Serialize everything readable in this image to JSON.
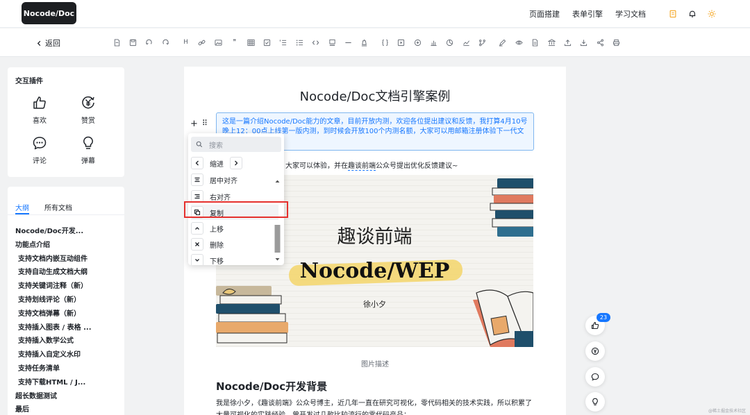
{
  "header": {
    "logo": "Nocode/Doc",
    "nav": [
      "页面搭建",
      "表单引擎",
      "学习文档"
    ],
    "icons": [
      "document-icon",
      "bell-icon",
      "sun-icon"
    ],
    "accent": "#f5a623"
  },
  "toolbar": {
    "back_label": "返回",
    "tools": [
      "file-icon",
      "save-icon",
      "undo-icon",
      "redo-icon",
      "heading-icon",
      "link-icon",
      "image-icon",
      "quote-icon",
      "table-icon",
      "checkbox-icon",
      "ordered-list-icon",
      "bullet-list-icon",
      "code-icon",
      "highlight-icon",
      "divider-icon",
      "clear-format-icon",
      "braces-icon",
      "video-icon",
      "embed-icon",
      "bar-chart-icon",
      "pie-chart-icon",
      "line-chart-icon",
      "flow-icon",
      "pen-icon",
      "preview-icon",
      "export-doc-icon",
      "bank-icon",
      "upload-icon",
      "download-icon",
      "share-icon",
      "print-icon"
    ],
    "heading_glyph": "H",
    "quote_glyph": "❞"
  },
  "plugins": {
    "title": "交互插件",
    "items": [
      {
        "label": "喜欢",
        "icon": "thumbs-up-icon"
      },
      {
        "label": "赞赏",
        "icon": "yen-icon"
      },
      {
        "label": "评论",
        "icon": "comment-icon"
      },
      {
        "label": "弹幕",
        "icon": "lightbulb-icon"
      }
    ]
  },
  "outline": {
    "tabs": [
      "大纲",
      "所有文档"
    ],
    "active_tab": "大纲",
    "items": [
      {
        "label": "Nocode/Doc开发...",
        "level": 1
      },
      {
        "label": "功能点介绍",
        "level": 1
      },
      {
        "label": "支持文档内嵌互动组件",
        "level": 2
      },
      {
        "label": "支持自动生成文档大纲",
        "level": 2
      },
      {
        "label": "支持关键词注释（新）",
        "level": 2
      },
      {
        "label": "支持划线评论（新）",
        "level": 2
      },
      {
        "label": "支持文档弹幕（新）",
        "level": 2
      },
      {
        "label": "支持插入图表 / 表格 ...",
        "level": 2
      },
      {
        "label": "支持插入数学公式",
        "level": 2
      },
      {
        "label": "支持插入自定义水印",
        "level": 2
      },
      {
        "label": "支持任务清单",
        "level": 2
      },
      {
        "label": "支持下载HTML / J...",
        "level": 2
      },
      {
        "label": "超长数据测试",
        "level": 1
      },
      {
        "label": "最后",
        "level": 1
      }
    ]
  },
  "doc": {
    "title": "Nocode/Doc文档引擎案例",
    "callout": "这是一篇介绍Nocode/Doc能力的文章，目前开放内测，欢迎各位提出建议和反馈，我打算4月10号晚上12：00点上线第一版内测，到时候会开放100个内测名额，大家可以用邮箱注册体验下一代文档引擎的效果。",
    "para1_pre": "研的文档编辑器编写，大家可以体验，并在",
    "para1_link": "趣谈前端",
    "para1_post": "公众号提出优化反馈建议~",
    "image": {
      "line1": "趣谈前端",
      "line2": "Nocode/WEP",
      "line3": "徐小夕"
    },
    "caption": "图片描述",
    "h2": "Nocode/Doc开发背景",
    "para2": "我是徐小夕，《趣谈前端》公众号博主，近几年一直在研究可视化，零代码相关的技术实践，所以积累了大量可视化的实践经验，曾开发过几款比较流行的零代码产品："
  },
  "menu": {
    "search_placeholder": "搜索",
    "indent_label": "缩进",
    "items": [
      {
        "label": "居中对齐",
        "icon": "align-center-icon"
      },
      {
        "label": "右对齐",
        "icon": "align-right-icon"
      },
      {
        "label": "复制",
        "icon": "copy-icon"
      },
      {
        "label": "上移",
        "icon": "move-up-icon"
      },
      {
        "label": "删除",
        "icon": "delete-icon"
      },
      {
        "label": "下移",
        "icon": "move-down-icon"
      }
    ],
    "highlighted": "复制",
    "highlight_color": "#e5302d"
  },
  "floating": {
    "like_count": "23",
    "buttons": [
      "thumbs-up-icon",
      "yen-icon",
      "comment-icon",
      "lightbulb-icon"
    ]
  },
  "watermark": "@稀土掘金技术社区"
}
